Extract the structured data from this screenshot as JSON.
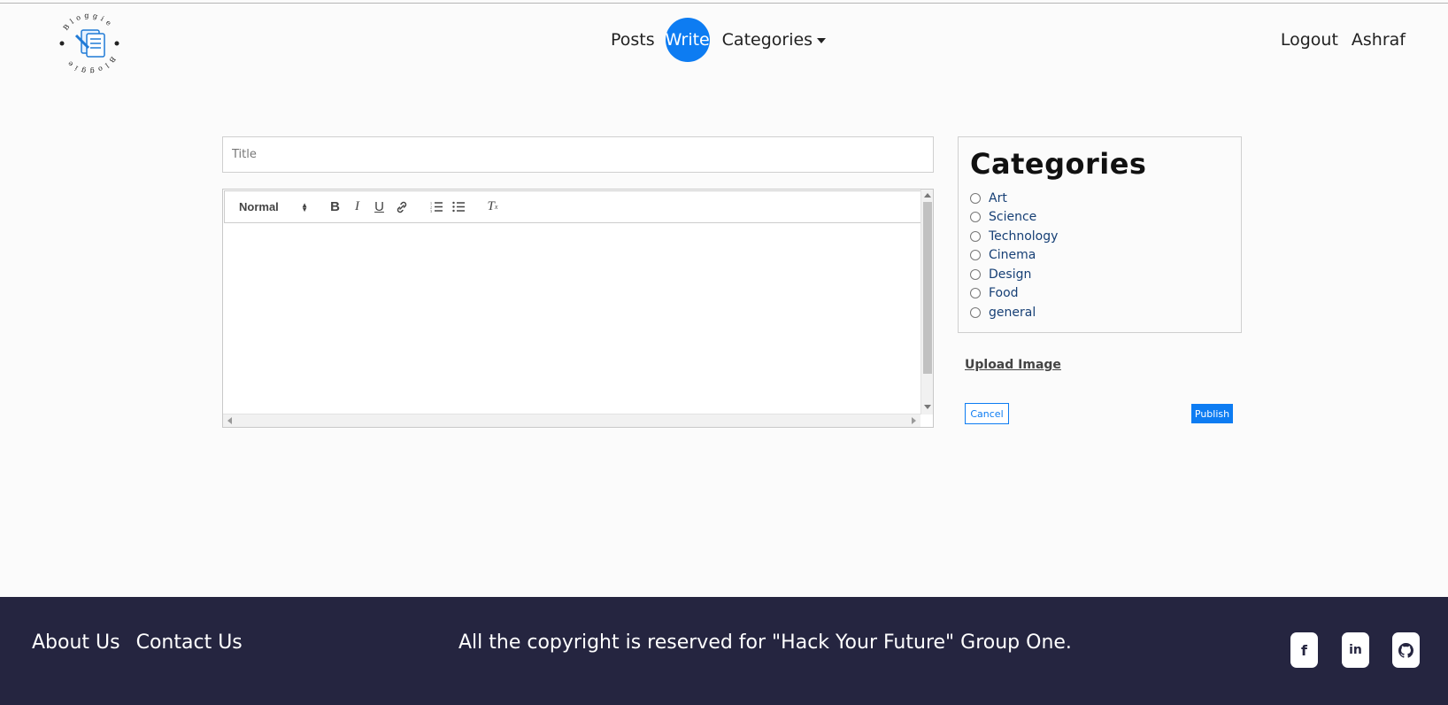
{
  "colors": {
    "accent": "#0d7cf2",
    "footer_bg": "#252540",
    "category_text": "#163f75"
  },
  "header": {
    "logo_text": "Bloggie",
    "nav": {
      "posts": "Posts",
      "write": "Write",
      "categories": "Categories"
    },
    "logout": "Logout",
    "username": "Ashraf"
  },
  "form": {
    "title_placeholder": "Title",
    "editor": {
      "format_select": "Normal",
      "toolbar_icons": [
        "bold-icon",
        "italic-icon",
        "underline-icon",
        "link-icon",
        "ordered-list-icon",
        "bullet-list-icon",
        "clear-format-icon"
      ]
    }
  },
  "categories": {
    "heading": "Categories",
    "items": [
      "Art",
      "Science",
      "Technology",
      "Cinema",
      "Design",
      "Food",
      "general"
    ]
  },
  "actions": {
    "upload": "Upload Image",
    "cancel": "Cancel",
    "publish": "Publish"
  },
  "footer": {
    "about": "About Us",
    "contact": "Contact Us",
    "copyright": "All the copyright is reserved for \"Hack Your Future\" Group One.",
    "social_icons": [
      "facebook-icon",
      "linkedin-icon",
      "github-icon"
    ]
  }
}
